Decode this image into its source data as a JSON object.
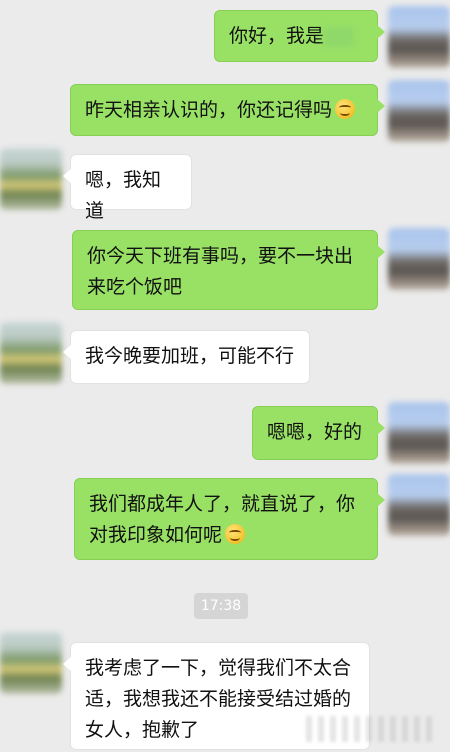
{
  "chat": {
    "messages": [
      {
        "sender": "me",
        "text": "你好，我是"
      },
      {
        "sender": "me",
        "text": "昨天相亲认识的，你还记得吗",
        "emoji": "smile-emoji"
      },
      {
        "sender": "them",
        "text": "嗯，我知道"
      },
      {
        "sender": "me",
        "text": "你今天下班有事吗，要不一块出来吃个饭吧"
      },
      {
        "sender": "them",
        "text": "我今晚要加班，可能不行"
      },
      {
        "sender": "me",
        "text": "嗯嗯，好的"
      },
      {
        "sender": "me",
        "text": "我们都成年人了，就直说了，你对我印象如何呢",
        "emoji": "smile-emoji"
      },
      {
        "sender": "them",
        "text": "我考虑了一下，觉得我们不太合适，我想我还不能接受结过婚的女人，抱歉了"
      }
    ],
    "timestamp": "17:38"
  },
  "colors": {
    "background": "#ebebeb",
    "my_bubble": "#98e165",
    "their_bubble": "#ffffff"
  }
}
